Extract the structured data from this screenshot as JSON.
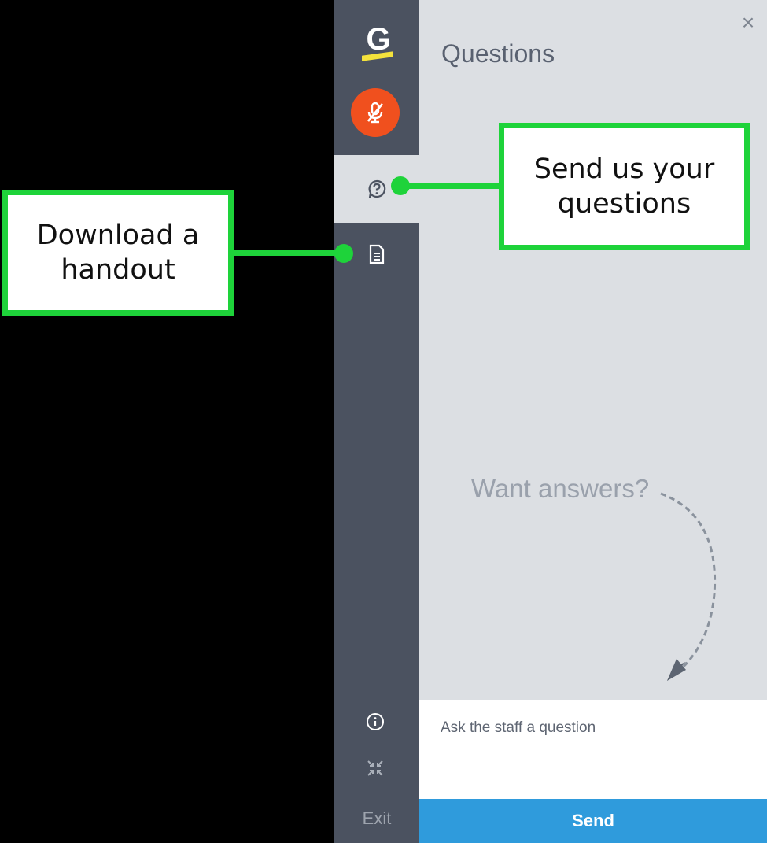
{
  "sidebar": {
    "logo_letter": "G",
    "exit_label": "Exit",
    "icons": {
      "mic": "mic-muted-icon",
      "questions": "question-bubble-icon",
      "handout": "document-icon",
      "info": "info-icon",
      "shrink": "shrink-icon"
    }
  },
  "panel": {
    "title": "Questions",
    "close_label": "×",
    "empty_hint": "Want answers?",
    "input_placeholder": "Ask the staff a question",
    "send_label": "Send"
  },
  "callouts": {
    "handout": "Download a handout",
    "questions": "Send us your questions"
  },
  "colors": {
    "sidebar_bg": "#4b5260",
    "panel_bg": "#dcdfe3",
    "mic_button": "#f0501e",
    "send_button": "#2f9bdc",
    "callout_border": "#1ed33a",
    "logo_accent": "#f4e23c"
  }
}
